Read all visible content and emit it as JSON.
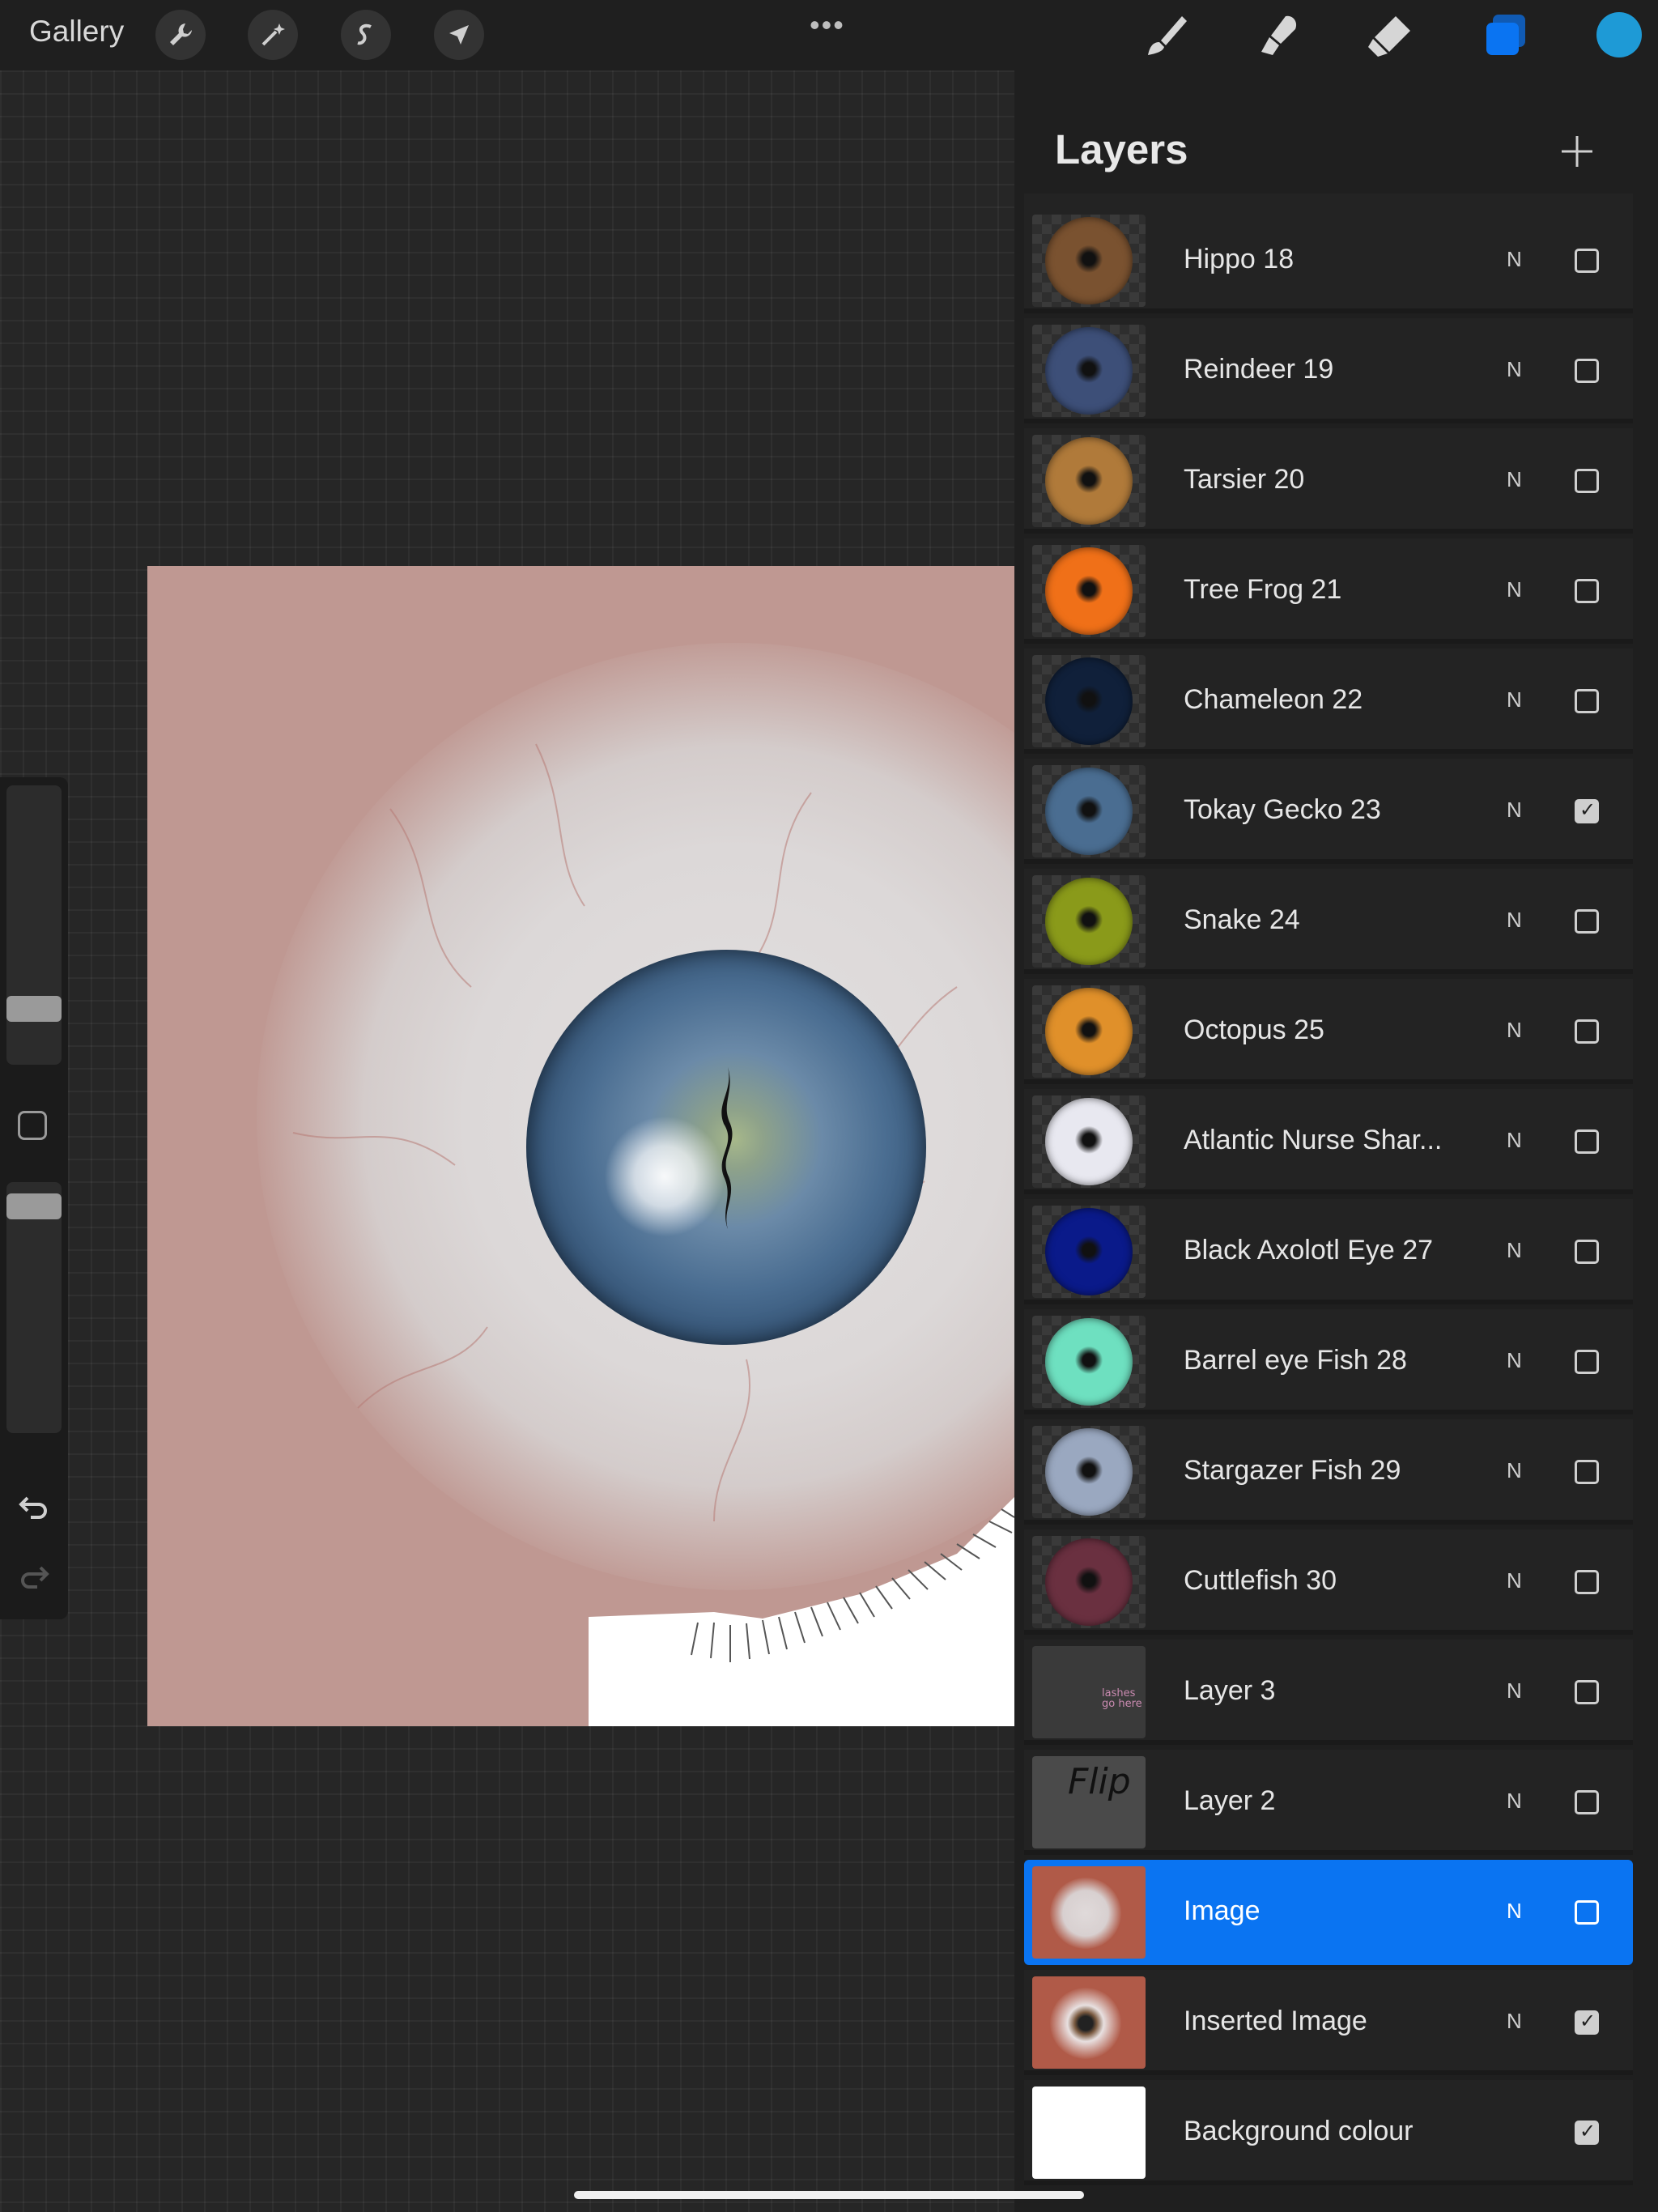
{
  "topbar": {
    "gallery_label": "Gallery",
    "more_label": "•••",
    "tools": [
      "wrench-icon",
      "magic-wand-icon",
      "selection-icon",
      "transform-icon"
    ],
    "right_tools": [
      "brush-icon",
      "smudge-icon",
      "eraser-icon",
      "layers-icon"
    ],
    "current_color": "#1e9ad6"
  },
  "panel": {
    "title": "Layers",
    "add_label": "+"
  },
  "layers": [
    {
      "name": "Hippo 18",
      "mode": "N",
      "visible": false,
      "thumb": "#7a5230"
    },
    {
      "name": "Reindeer 19",
      "mode": "N",
      "visible": false,
      "thumb": "#3d4f78"
    },
    {
      "name": "Tarsier 20",
      "mode": "N",
      "visible": false,
      "thumb": "#b07a3a"
    },
    {
      "name": "Tree Frog 21",
      "mode": "N",
      "visible": false,
      "thumb": "#f07018"
    },
    {
      "name": "Chameleon 22",
      "mode": "N",
      "visible": false,
      "thumb": "#10203a"
    },
    {
      "name": "Tokay Gecko 23",
      "mode": "N",
      "visible": true,
      "thumb": "#4a6d91"
    },
    {
      "name": "Snake 24",
      "mode": "N",
      "visible": false,
      "thumb": "#8a9a1a"
    },
    {
      "name": "Octopus 25",
      "mode": "N",
      "visible": false,
      "thumb": "#e0902a"
    },
    {
      "name": "Atlantic Nurse Shar...",
      "mode": "N",
      "visible": false,
      "thumb": "#e8e8f0"
    },
    {
      "name": "Black Axolotl Eye 27",
      "mode": "N",
      "visible": false,
      "thumb": "#0a1a8a"
    },
    {
      "name": "Barrel eye Fish 28",
      "mode": "N",
      "visible": false,
      "thumb": "#6ee0c0"
    },
    {
      "name": "Stargazer Fish 29",
      "mode": "N",
      "visible": false,
      "thumb": "#9aa8c0"
    },
    {
      "name": "Cuttlefish 30",
      "mode": "N",
      "visible": false,
      "thumb": "#6a3040"
    },
    {
      "name": "Layer 3",
      "mode": "N",
      "visible": false,
      "thumb": "#3a3a3a"
    },
    {
      "name": "Layer 2",
      "mode": "N",
      "visible": false,
      "thumb": "#4a4a4a"
    },
    {
      "name": "Image",
      "mode": "N",
      "visible": false,
      "selected": true,
      "thumb": "#b05a48"
    },
    {
      "name": "Inserted Image",
      "mode": "N",
      "visible": true,
      "thumb": "#b05a48"
    },
    {
      "name": "Background colour",
      "mode": "",
      "visible": true,
      "thumb": "#ffffff"
    }
  ],
  "layer3_sketch_text": "lashes go here",
  "layer2_sketch_text": "Flip"
}
